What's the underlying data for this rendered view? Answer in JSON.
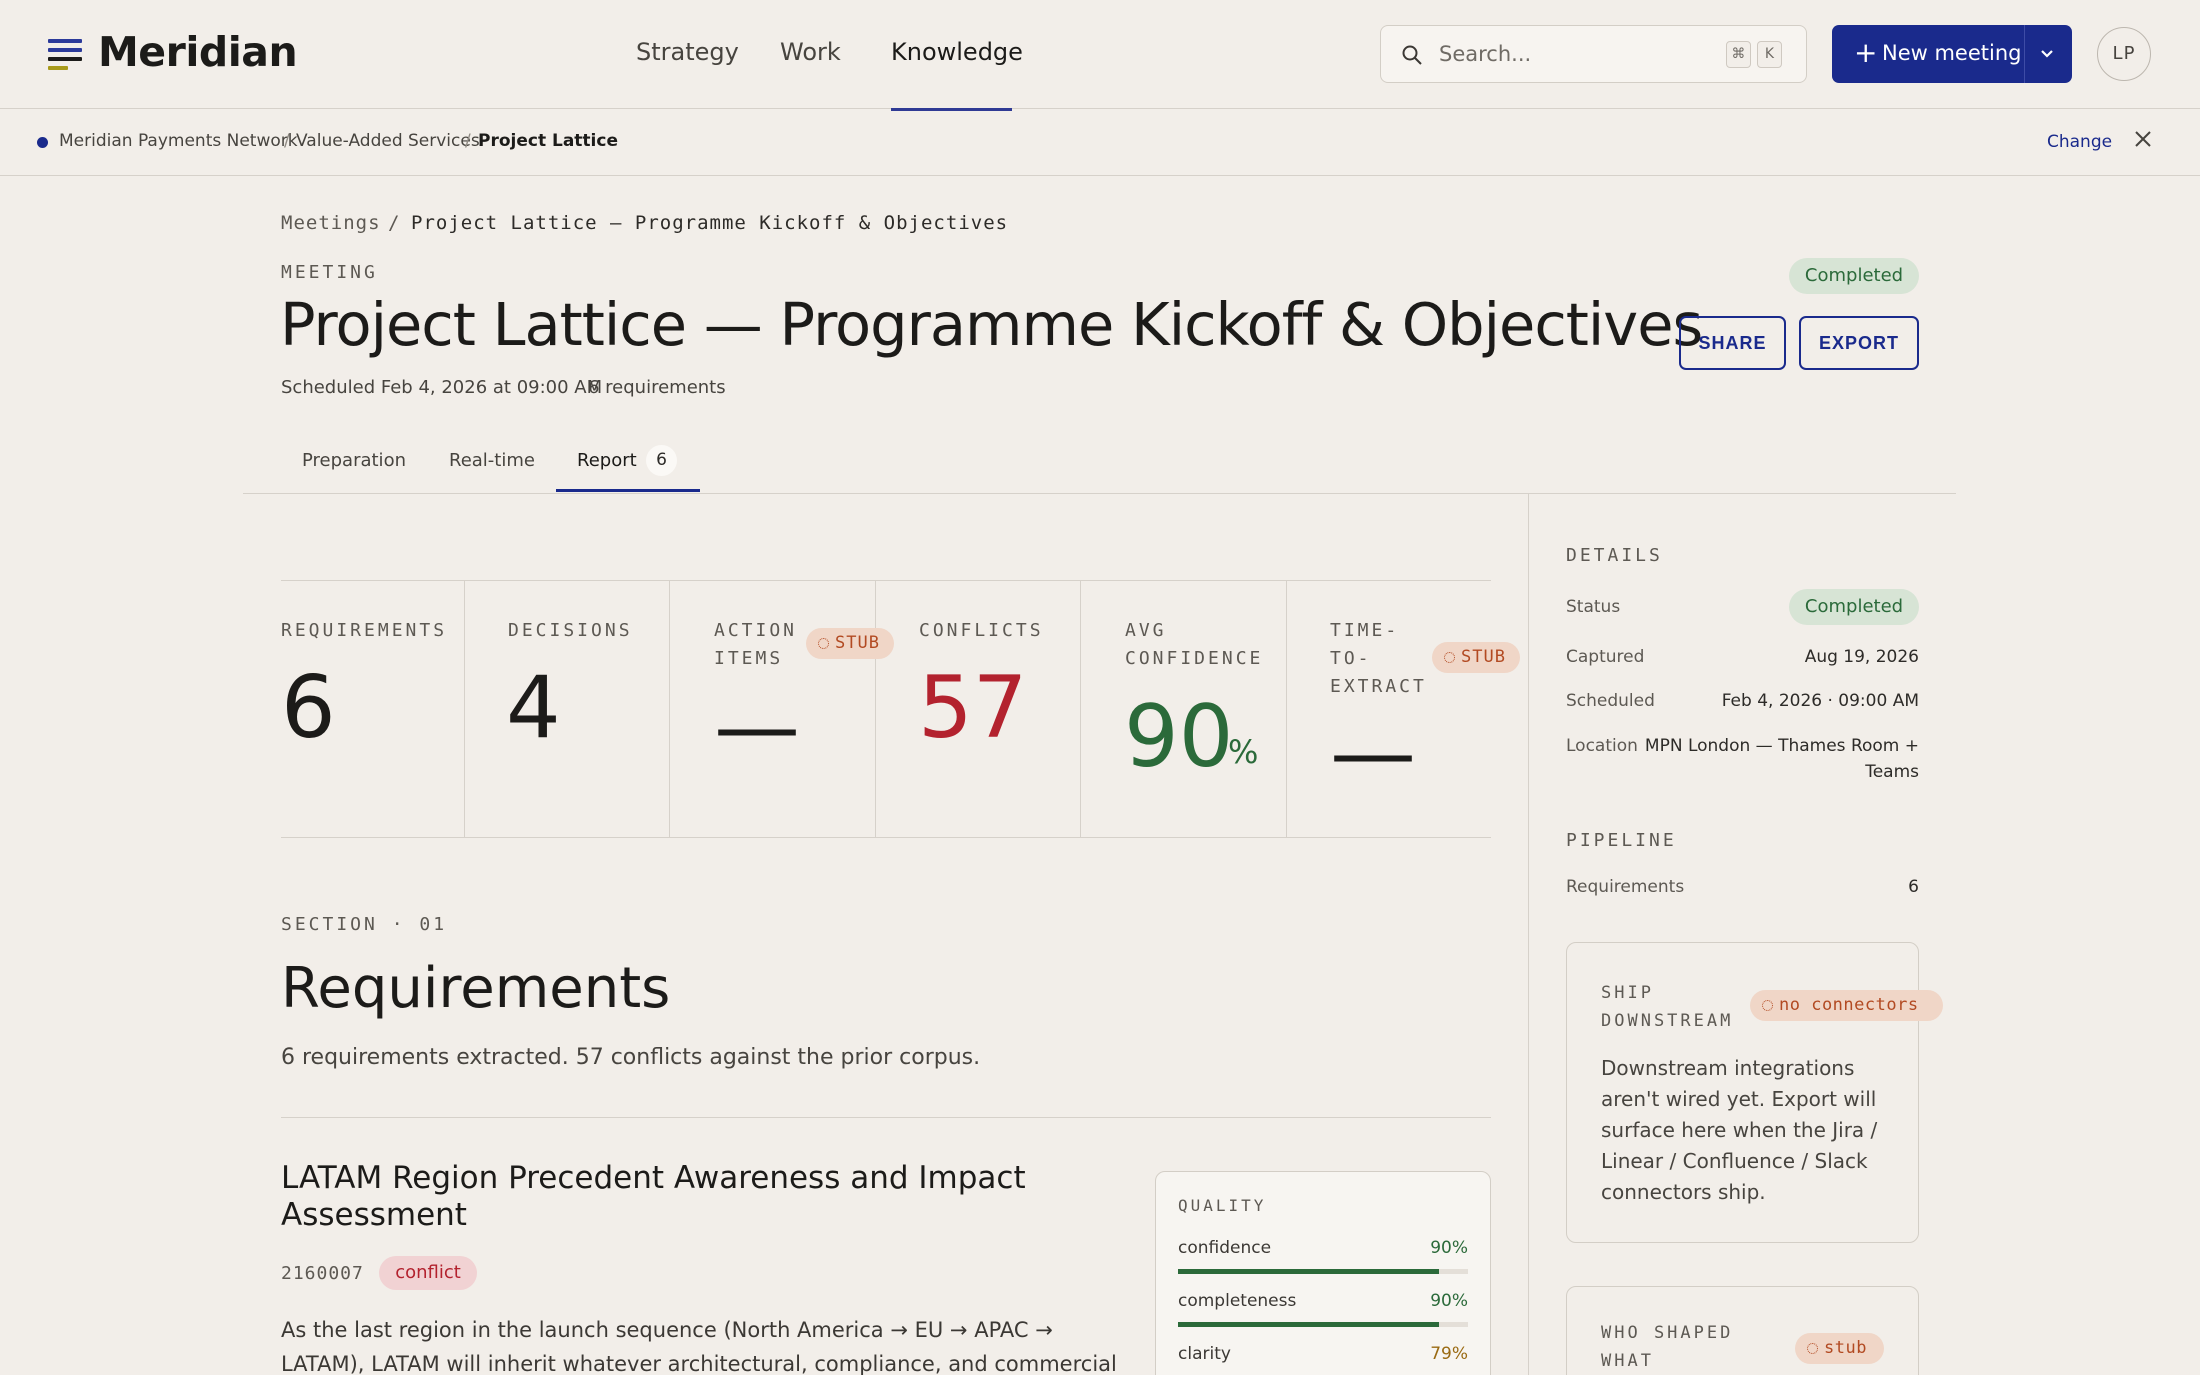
{
  "app": {
    "brand": "Meridian",
    "nav": [
      "Strategy",
      "Work",
      "Knowledge"
    ],
    "search_placeholder": "Search...",
    "search_kbd": [
      "⌘",
      "K"
    ],
    "new_meeting_label": "New meeting",
    "avatar_initials": "LP",
    "accent": "#1a2a8c"
  },
  "context": {
    "org": "Meridian Payments Network",
    "area": "Value-Added Services",
    "project": "Project Lattice",
    "change_label": "Change"
  },
  "breadcrumb": {
    "root": "Meetings",
    "sep": "/",
    "current": "Project Lattice — Programme Kickoff & Objectives"
  },
  "meeting": {
    "eyebrow": "MEETING",
    "title": "Project Lattice — Programme Kickoff & Objectives",
    "scheduled": "Scheduled Feb 4, 2026 at 09:00 AM",
    "req_count": "6 requirements",
    "status": "Completed",
    "share_label": "SHARE",
    "export_label": "EXPORT"
  },
  "tabs": [
    {
      "label": "Preparation"
    },
    {
      "label": "Real-time"
    },
    {
      "label": "Report",
      "badge": "6"
    }
  ],
  "stats": {
    "requirements": {
      "label": "REQUIREMENTS",
      "value": "6"
    },
    "decisions": {
      "label": "DECISIONS",
      "value": "4"
    },
    "action_items": {
      "label1": "ACTION",
      "label2": "ITEMS",
      "value": "—",
      "stub": "STUB"
    },
    "conflicts": {
      "label": "CONFLICTS",
      "value": "57"
    },
    "avg_confidence": {
      "label1": "AVG",
      "label2": "CONFIDENCE",
      "value": "90",
      "unit": "%"
    },
    "time_to_extract": {
      "label1": "TIME-",
      "label2": "TO-",
      "label3": "EXTRACT",
      "value": "—",
      "stub": "STUB"
    }
  },
  "section": {
    "eyebrow": "SECTION · 01",
    "title": "Requirements",
    "desc": "6 requirements extracted. 57 conflicts against the prior corpus."
  },
  "requirement": {
    "title": "LATAM Region Precedent Awareness and Impact Assessment",
    "id": "2160007",
    "tag": "conflict",
    "body": "As the last region in the launch sequence (North America → EU → APAC → LATAM), LATAM will inherit whatever architectural, compliance, and commercial precedents"
  },
  "quality": {
    "heading": "QUALITY",
    "rows": [
      {
        "label": "confidence",
        "value": "90%",
        "level": 0.9,
        "color": "#2b6a3a"
      },
      {
        "label": "completeness",
        "value": "90%",
        "level": 0.9,
        "color": "#2b6a3a"
      },
      {
        "label": "clarity",
        "value": "79%",
        "level": 0.79,
        "color": "#9a6a12"
      }
    ]
  },
  "details": {
    "heading": "DETAILS",
    "status_key": "Status",
    "status_val": "Completed",
    "captured_key": "Captured",
    "captured_val": "Aug 19, 2026",
    "scheduled_key": "Scheduled",
    "scheduled_val": "Feb 4, 2026 · 09:00 AM",
    "location_key": "Location",
    "location_val1": "MPN London — Thames Room +",
    "location_val2": "Teams"
  },
  "pipeline": {
    "heading": "PIPELINE",
    "req_key": "Requirements",
    "req_val": "6"
  },
  "ship": {
    "head1": "SHIP",
    "head2": "DOWNSTREAM",
    "tag": "no connectors",
    "body": "Downstream integrations aren't wired yet. Export will surface here when the Jira / Linear / Confluence / Slack connectors ship."
  },
  "who": {
    "head1": "WHO SHAPED",
    "head2": "WHAT",
    "tag": "stub"
  }
}
